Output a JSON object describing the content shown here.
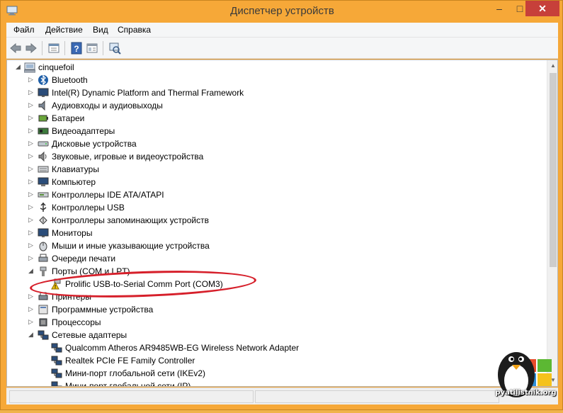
{
  "window": {
    "title": "Диспетчер устройств",
    "controls": {
      "minimize": "–",
      "maximize": "□",
      "close": "✕"
    }
  },
  "menu": {
    "items": [
      "Файл",
      "Действие",
      "Вид",
      "Справка"
    ]
  },
  "toolbar": {
    "buttons": [
      "back-icon",
      "forward-icon",
      "properties-icon",
      "help-icon",
      "details-icon",
      "scan-hardware-icon"
    ]
  },
  "tree": {
    "root": "cinquefoil",
    "categories": [
      {
        "label": "Bluetooth",
        "icon": "bluetooth-icon",
        "expanded": false
      },
      {
        "label": "Intel(R) Dynamic Platform and Thermal Framework",
        "icon": "monitor-icon",
        "expanded": false
      },
      {
        "label": "Аудиовходы и аудиовыходы",
        "icon": "speaker-icon",
        "expanded": false
      },
      {
        "label": "Батареи",
        "icon": "battery-icon",
        "expanded": false
      },
      {
        "label": "Видеоадаптеры",
        "icon": "display-adapter-icon",
        "expanded": false
      },
      {
        "label": "Дисковые устройства",
        "icon": "disk-icon",
        "expanded": false
      },
      {
        "label": "Звуковые, игровые и видеоустройства",
        "icon": "sound-icon",
        "expanded": false
      },
      {
        "label": "Клавиатуры",
        "icon": "keyboard-icon",
        "expanded": false
      },
      {
        "label": "Компьютер",
        "icon": "computer-icon",
        "expanded": false
      },
      {
        "label": "Контроллеры IDE ATA/ATAPI",
        "icon": "ide-icon",
        "expanded": false
      },
      {
        "label": "Контроллеры USB",
        "icon": "usb-icon",
        "expanded": false
      },
      {
        "label": "Контроллеры запоминающих устройств",
        "icon": "storage-icon",
        "expanded": false
      },
      {
        "label": "Мониторы",
        "icon": "monitor-icon",
        "expanded": false
      },
      {
        "label": "Мыши и иные указывающие устройства",
        "icon": "mouse-icon",
        "expanded": false
      },
      {
        "label": "Очереди печати",
        "icon": "print-queue-icon",
        "expanded": false
      },
      {
        "label": "Порты (COM и LPT)",
        "icon": "port-icon",
        "expanded": true,
        "children": [
          {
            "label": "Prolific USB-to-Serial Comm Port (COM3)",
            "icon": "warning-port-icon"
          }
        ]
      },
      {
        "label": "Принтеры",
        "icon": "printer-icon",
        "expanded": false
      },
      {
        "label": "Программные устройства",
        "icon": "software-device-icon",
        "expanded": false
      },
      {
        "label": "Процессоры",
        "icon": "processor-icon",
        "expanded": false
      },
      {
        "label": "Сетевые адаптеры",
        "icon": "network-icon",
        "expanded": true,
        "children": [
          {
            "label": "Qualcomm Atheros AR9485WB-EG Wireless Network Adapter",
            "icon": "network-icon"
          },
          {
            "label": "Realtek PCIe FE Family Controller",
            "icon": "network-icon"
          },
          {
            "label": "Мини-порт глобальной сети (IKEv2)",
            "icon": "network-icon"
          },
          {
            "label": "Мини-порт глобальной сети (IP)",
            "icon": "network-icon"
          }
        ]
      }
    ]
  },
  "watermark": {
    "text": "pyatilistnik.org"
  },
  "colors": {
    "frame": "#f6a838",
    "close": "#c7403a",
    "highlight": "#d61f2a"
  }
}
